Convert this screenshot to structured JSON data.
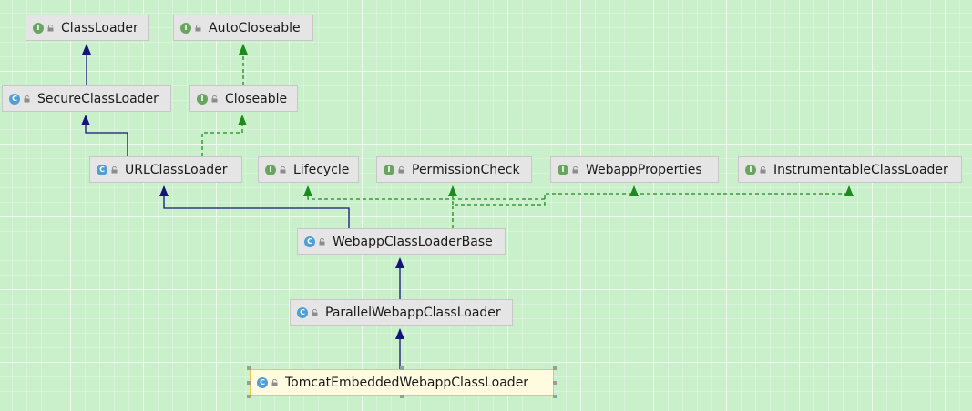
{
  "nodes": [
    {
      "id": "classloader",
      "kind": "interface",
      "label": "ClassLoader"
    },
    {
      "id": "autocloseable",
      "kind": "interface",
      "label": "AutoCloseable"
    },
    {
      "id": "secureclassloader",
      "kind": "class",
      "label": "SecureClassLoader"
    },
    {
      "id": "closeable",
      "kind": "interface",
      "label": "Closeable"
    },
    {
      "id": "urlclassloader",
      "kind": "class",
      "label": "URLClassLoader"
    },
    {
      "id": "lifecycle",
      "kind": "interface",
      "label": "Lifecycle"
    },
    {
      "id": "permissioncheck",
      "kind": "interface",
      "label": "PermissionCheck"
    },
    {
      "id": "webappproperties",
      "kind": "interface",
      "label": "WebappProperties"
    },
    {
      "id": "instrumentableclassloader",
      "kind": "interface",
      "label": "InstrumentableClassLoader"
    },
    {
      "id": "webappclassloaderbase",
      "kind": "class",
      "label": "WebappClassLoaderBase"
    },
    {
      "id": "parallelwebappclassloader",
      "kind": "class",
      "label": "ParallelWebappClassLoader"
    },
    {
      "id": "tomcatembeddedwebappclassloader",
      "kind": "class",
      "label": "TomcatEmbeddedWebappClassLoader",
      "selected": true
    }
  ],
  "badges": {
    "interface": "I",
    "class": "C"
  },
  "colors": {
    "background": "#c9efcb",
    "extends_edge": "#14147a",
    "implements_edge": "#1e8a1e",
    "interface_badge": "#6aa560",
    "class_badge": "#4f9fd6",
    "selected_border": "#e7c94d"
  },
  "edges": [
    {
      "from": "secureclassloader",
      "to": "classloader",
      "type": "extends"
    },
    {
      "from": "closeable",
      "to": "autocloseable",
      "type": "implements"
    },
    {
      "from": "urlclassloader",
      "to": "secureclassloader",
      "type": "extends"
    },
    {
      "from": "urlclassloader",
      "to": "closeable",
      "type": "implements"
    },
    {
      "from": "webappclassloaderbase",
      "to": "urlclassloader",
      "type": "extends"
    },
    {
      "from": "webappclassloaderbase",
      "to": "lifecycle",
      "type": "implements"
    },
    {
      "from": "webappclassloaderbase",
      "to": "permissioncheck",
      "type": "implements"
    },
    {
      "from": "webappclassloaderbase",
      "to": "webappproperties",
      "type": "implements"
    },
    {
      "from": "webappclassloaderbase",
      "to": "instrumentableclassloader",
      "type": "implements"
    },
    {
      "from": "parallelwebappclassloader",
      "to": "webappclassloaderbase",
      "type": "extends"
    },
    {
      "from": "tomcatembeddedwebappclassloader",
      "to": "parallelwebappclassloader",
      "type": "extends"
    }
  ]
}
